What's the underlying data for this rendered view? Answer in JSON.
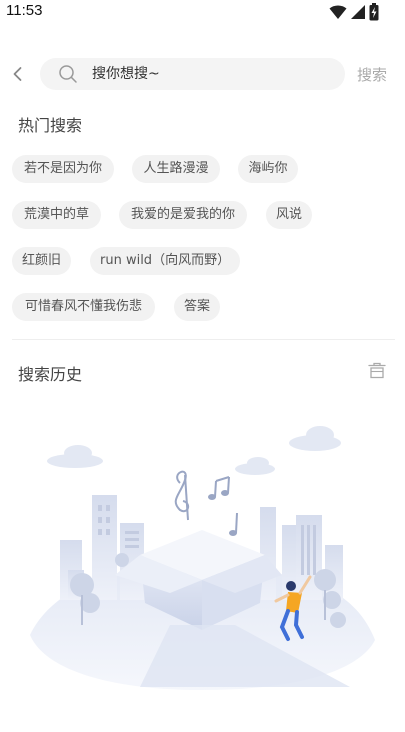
{
  "status_bar": {
    "time": "11:53",
    "icons": [
      "wifi-icon",
      "cell-signal-icon",
      "battery-charging-icon"
    ]
  },
  "search": {
    "back_icon": "chevron-left-icon",
    "search_icon": "magnifier-icon",
    "placeholder": "搜你想搜~",
    "value": "",
    "submit_label": "搜索"
  },
  "hot": {
    "title": "热门搜索",
    "tags": [
      "若不是因为你",
      "人生路漫漫",
      "海屿你",
      "荒漠中的草",
      "我爱的是爱我的你",
      "风说",
      "红颜旧",
      "run wild（向风而野）",
      "可惜春风不懂我伤悲",
      "答案"
    ]
  },
  "history": {
    "title": "搜索历史",
    "clear_icon": "trash-icon"
  },
  "empty_state": {
    "illustration": "music-box-city-illustration"
  }
}
